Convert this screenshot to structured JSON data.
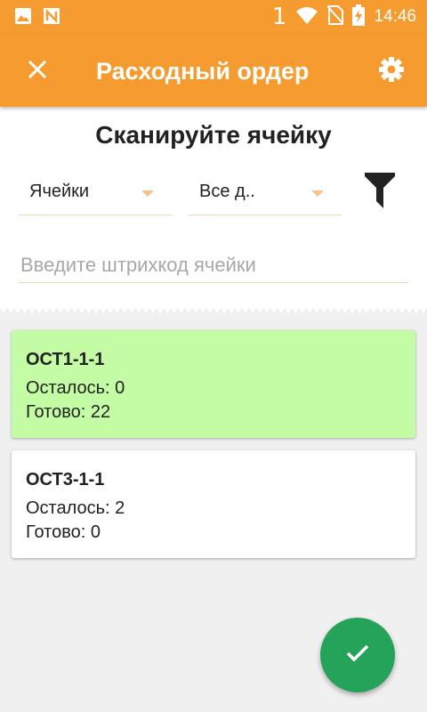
{
  "status_bar": {
    "time": "14:46",
    "sim_slot": "1",
    "icons": [
      "image-icon",
      "n-icon",
      "wifi-icon",
      "no-sim-icon",
      "battery-charging-icon"
    ]
  },
  "app_bar": {
    "title": "Расходный ордер",
    "close_icon": "close-icon",
    "settings_icon": "gear-icon"
  },
  "scan": {
    "heading": "Сканируйте ячейку",
    "cells_dropdown": "Ячейки",
    "all_dropdown": "Все д..",
    "filter_icon": "filter-icon",
    "barcode_placeholder": "Введите штрихкод ячейки",
    "barcode_value": ""
  },
  "cells": [
    {
      "code": "ОСТ1-1-1",
      "remaining": "Осталось: 0",
      "ready": "Готово: 22",
      "color": "#c3fca4"
    },
    {
      "code": "ОСТ3-1-1",
      "remaining": "Осталось: 2",
      "ready": "Готово: 0",
      "color": "#ffffff"
    }
  ],
  "fab": {
    "icon": "check-icon"
  },
  "colors": {
    "accent": "#f59b30",
    "done_card": "#c3fca4",
    "fab": "#26a35a"
  }
}
